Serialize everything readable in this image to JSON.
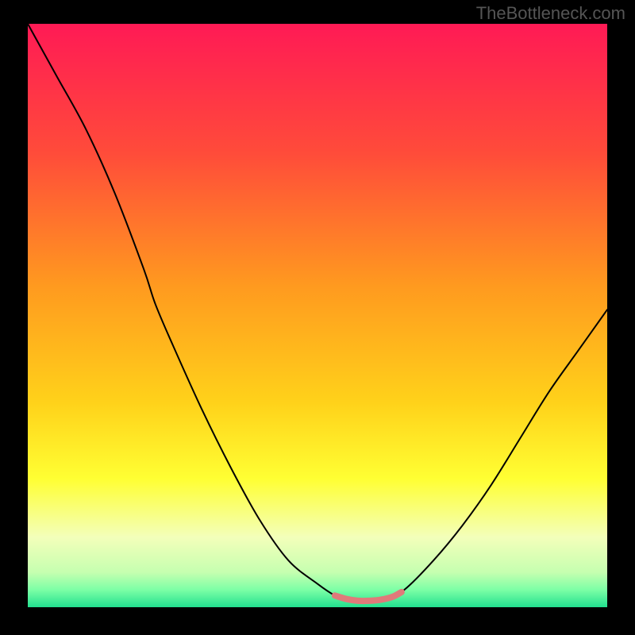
{
  "watermark": "TheBottleneck.com",
  "chart_data": {
    "type": "line",
    "title": "",
    "xlabel": "",
    "ylabel": "",
    "xlim": [
      0,
      100
    ],
    "ylim": [
      0,
      100
    ],
    "background_gradient": {
      "stops": [
        {
          "offset": 0,
          "color": "#ff1a55"
        },
        {
          "offset": 22,
          "color": "#ff4b3a"
        },
        {
          "offset": 45,
          "color": "#ff9a1f"
        },
        {
          "offset": 65,
          "color": "#ffd21a"
        },
        {
          "offset": 78,
          "color": "#ffff33"
        },
        {
          "offset": 88,
          "color": "#f3ffba"
        },
        {
          "offset": 94,
          "color": "#c6ffb0"
        },
        {
          "offset": 97,
          "color": "#7dffa6"
        },
        {
          "offset": 100,
          "color": "#22e08f"
        }
      ]
    },
    "series": [
      {
        "name": "bottleneck-curve",
        "color": "#000000",
        "width": 2,
        "x": [
          0,
          5,
          10,
          15,
          20,
          22,
          25,
          30,
          35,
          40,
          45,
          50,
          53,
          55,
          58,
          60,
          62,
          65,
          70,
          75,
          80,
          85,
          90,
          95,
          100
        ],
        "y": [
          100,
          91,
          82,
          71,
          58,
          52,
          45,
          34,
          24,
          15,
          8,
          4,
          2,
          1.3,
          1.1,
          1.2,
          1.6,
          3,
          8,
          14,
          21,
          29,
          37,
          44,
          51
        ]
      },
      {
        "name": "optimal-zone-highlight",
        "color": "#e07a7a",
        "width": 8,
        "x": [
          53,
          55,
          57,
          59,
          61,
          63,
          64.5
        ],
        "y": [
          2.0,
          1.4,
          1.1,
          1.1,
          1.3,
          1.8,
          2.6
        ]
      }
    ]
  }
}
